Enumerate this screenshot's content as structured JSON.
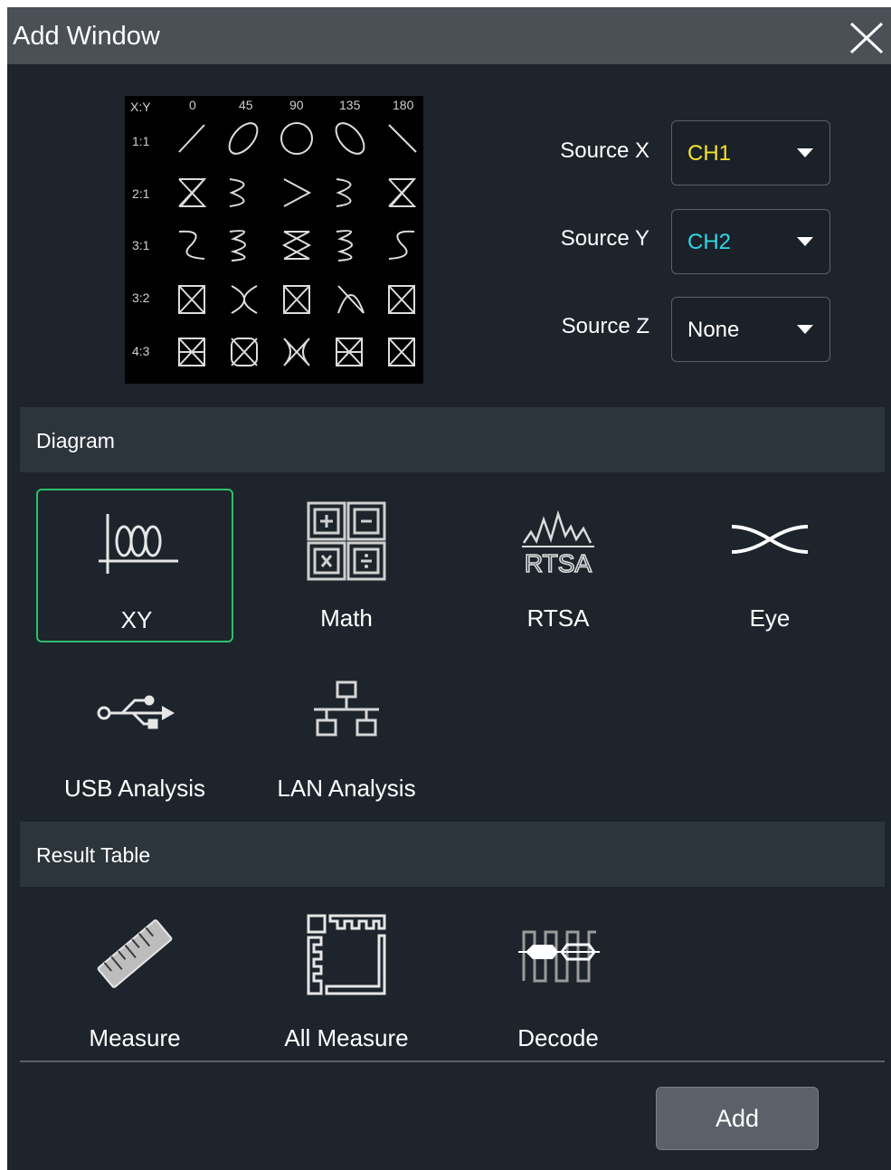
{
  "dialog": {
    "title": "Add Window",
    "close_icon": "close-icon"
  },
  "preview": {
    "column_headers": [
      "X:Y",
      "0",
      "45",
      "90",
      "135",
      "180"
    ],
    "row_labels": [
      "1:1",
      "2:1",
      "3:1",
      "3:2",
      "4:3"
    ],
    "icon": "lissajous-figures-grid"
  },
  "sources": {
    "x": {
      "label": "Source X",
      "value": "CH1",
      "color": "#f2e52b"
    },
    "y": {
      "label": "Source Y",
      "value": "CH2",
      "color": "#31d6e6"
    },
    "z": {
      "label": "Source Z",
      "value": "None",
      "color": "#ffffff"
    }
  },
  "diagram": {
    "section_title": "Diagram",
    "items": [
      {
        "label": "XY",
        "icon": "xy-icon",
        "selected": true
      },
      {
        "label": "Math",
        "icon": "math-icon",
        "selected": false
      },
      {
        "label": "RTSA",
        "icon": "rtsa-icon",
        "selected": false
      },
      {
        "label": "Eye",
        "icon": "eye-diagram-icon",
        "selected": false
      },
      {
        "label": "USB Analysis",
        "icon": "usb-icon",
        "selected": false
      },
      {
        "label": "LAN Analysis",
        "icon": "lan-icon",
        "selected": false
      }
    ]
  },
  "result_table": {
    "section_title": "Result Table",
    "items": [
      {
        "label": "Measure",
        "icon": "ruler-icon"
      },
      {
        "label": "All Measure",
        "icon": "all-measure-icon"
      },
      {
        "label": "Decode",
        "icon": "decode-icon"
      }
    ]
  },
  "footer": {
    "add_label": "Add"
  },
  "colors": {
    "selection_border": "#2fbf6a",
    "dialog_bg": "#1d242c",
    "title_bar": "#4a5056",
    "section_bar": "#2c343c"
  }
}
